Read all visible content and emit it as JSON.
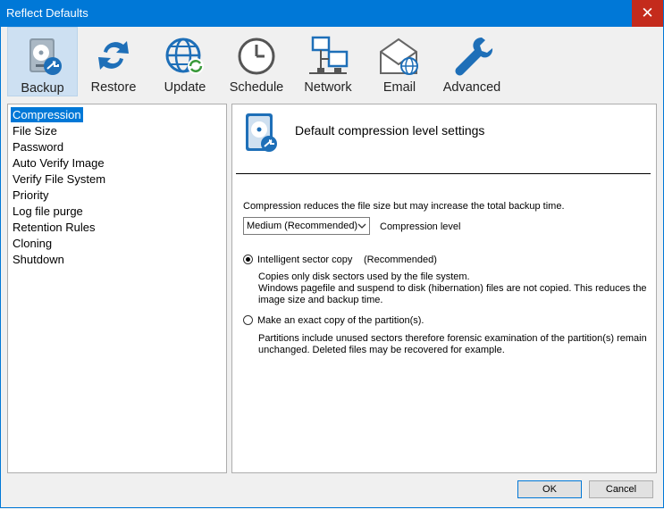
{
  "window": {
    "title": "Reflect Defaults",
    "close_glyph": "✕"
  },
  "toolbar": {
    "items": [
      {
        "label": "Backup",
        "icon": "backup-disk-icon",
        "selected": true
      },
      {
        "label": "Restore",
        "icon": "restore-arrows-icon"
      },
      {
        "label": "Update",
        "icon": "update-globe-icon"
      },
      {
        "label": "Schedule",
        "icon": "clock-icon"
      },
      {
        "label": "Network",
        "icon": "network-icon"
      },
      {
        "label": "Email",
        "icon": "email-icon"
      },
      {
        "label": "Advanced",
        "icon": "wrench-icon"
      }
    ]
  },
  "nav": {
    "items": [
      "Compression",
      "File Size",
      "Password",
      "Auto Verify Image",
      "Verify File System",
      "Priority",
      "Log file purge",
      "Retention Rules",
      "Cloning",
      "Shutdown"
    ],
    "selected": "Compression"
  },
  "panel": {
    "title": "Default compression level settings",
    "description": "Compression reduces the file size but may increase the total backup time.",
    "compression_select_value": "Medium (Recommended)",
    "compression_label": "Compression level",
    "option_intelligent_label": "Intelligent sector copy",
    "option_intelligent_tag": "(Recommended)",
    "option_intelligent_desc_1": "Copies only disk sectors used by the file system.",
    "option_intelligent_desc_2": "Windows pagefile and suspend to disk (hibernation) files are not copied. This reduces the",
    "option_intelligent_desc_3": "image size and backup time.",
    "option_exact_label": "Make an exact copy of the partition(s).",
    "option_exact_desc_1": "Partitions include unused sectors therefore forensic examination of the partition(s) remain",
    "option_exact_desc_2": "unchanged. Deleted files may be recovered for example.",
    "selected_option": "intelligent"
  },
  "buttons": {
    "ok": "OK",
    "cancel": "Cancel"
  },
  "colors": {
    "accent": "#0078d7",
    "close": "#c42b1c",
    "selected_tool": "#cde0f2"
  }
}
